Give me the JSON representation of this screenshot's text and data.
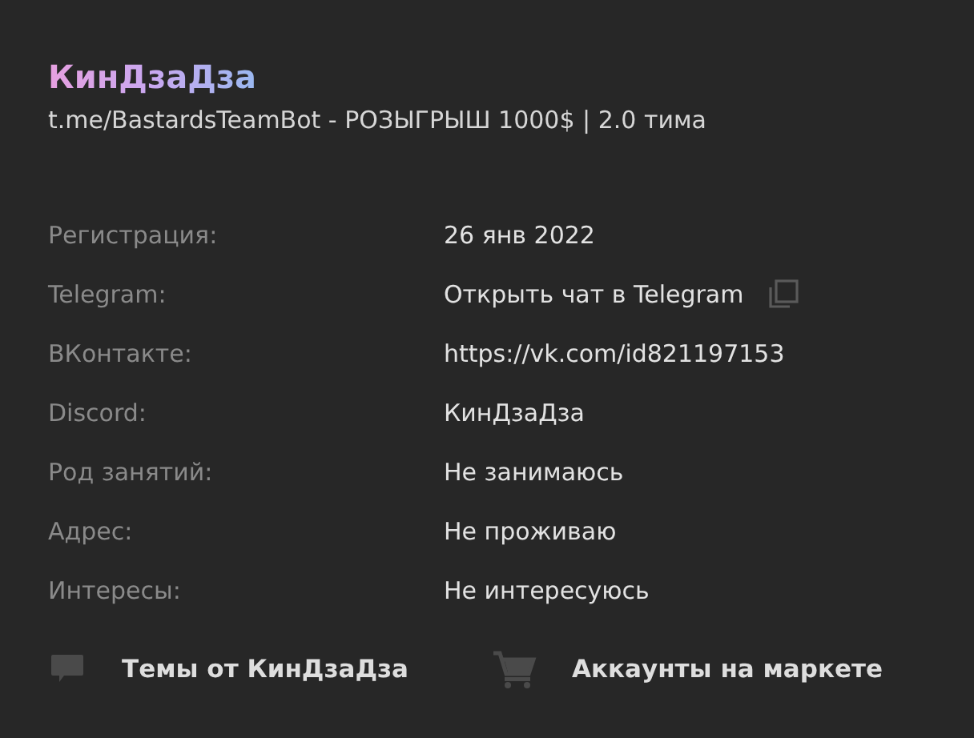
{
  "profile": {
    "name": "КинДзаДза",
    "status": "t.me/BastardsTeamBot - РОЗЫГРЫШ 1000$ | 2.0 тима"
  },
  "details": [
    {
      "label": "Регистрация:",
      "value": "26 янв 2022",
      "copyable": false
    },
    {
      "label": "Telegram:",
      "value": "Открыть чат в Telegram",
      "copyable": true
    },
    {
      "label": "ВКонтакте:",
      "value": "https://vk.com/id821197153",
      "copyable": false
    },
    {
      "label": "Discord:",
      "value": "КинДзаДза",
      "copyable": false
    },
    {
      "label": "Род занятий:",
      "value": "Не занимаюсь",
      "copyable": false
    },
    {
      "label": "Адрес:",
      "value": "Не проживаю",
      "copyable": false
    },
    {
      "label": "Интересы:",
      "value": "Не интересуюсь",
      "copyable": false
    }
  ],
  "links": [
    {
      "kind": "threads",
      "label": "Темы от КинДзаДза"
    },
    {
      "kind": "market",
      "label": "Аккаунты на маркете"
    }
  ]
}
